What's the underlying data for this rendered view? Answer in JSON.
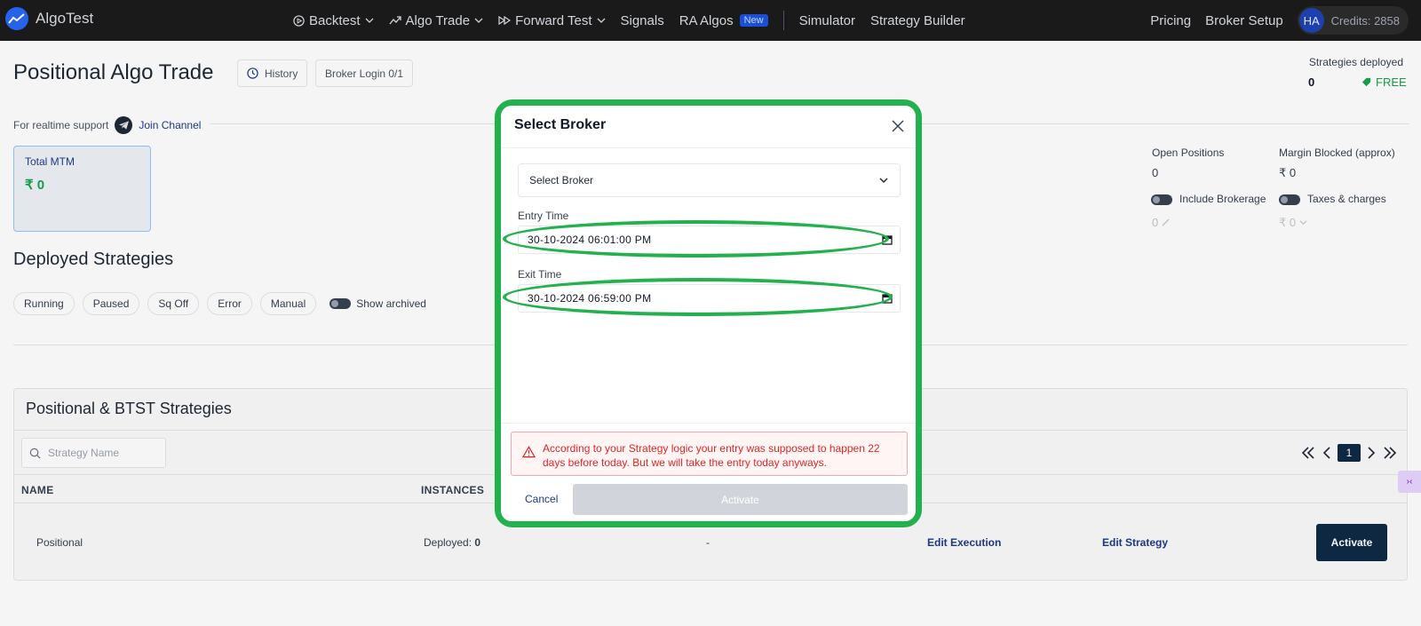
{
  "nav": {
    "brand": "AlgoTest",
    "links": [
      {
        "label": "Backtest",
        "icon": "play-circle-icon",
        "dropdown": true
      },
      {
        "label": "Algo Trade",
        "icon": "trend-up-icon",
        "dropdown": true
      },
      {
        "label": "Forward Test",
        "icon": "fast-forward-icon",
        "dropdown": true
      },
      {
        "label": "Signals"
      },
      {
        "label": "RA Algos",
        "badge": "New"
      }
    ],
    "links2": [
      "Simulator",
      "Strategy Builder"
    ],
    "right": {
      "pricing": "Pricing",
      "broker_setup": "Broker Setup",
      "avatar": "HA",
      "credits": "Credits: 2858"
    }
  },
  "page": {
    "title": "Positional Algo Trade",
    "history_btn": "History",
    "broker_login_btn": "Broker Login 0/1",
    "strategies_deployed_label": "Strategies deployed",
    "strategies_deployed_value": "0",
    "plan": "FREE"
  },
  "support": {
    "text": "For realtime support",
    "link": "Join Channel"
  },
  "mtm": {
    "label": "Total MTM",
    "value": "₹ 0"
  },
  "stats": {
    "open_positions_label": "Open Positions",
    "open_positions_value": "0",
    "margin_label": "Margin Blocked (approx)",
    "margin_value": "₹ 0",
    "include_brokerage": "Include Brokerage",
    "taxes_charges": "Taxes & charges",
    "brokerage_value": "0",
    "taxes_value": "₹ 0"
  },
  "deployed": {
    "title": "Deployed Strategies",
    "filters": [
      "Running",
      "Paused",
      "Sq Off",
      "Error",
      "Manual"
    ],
    "show_archived": "Show archived"
  },
  "strategies": {
    "title": "Positional & BTST Strategies",
    "search_placeholder": "Strategy Name",
    "page": "1",
    "columns": {
      "name": "NAME",
      "instances": "INSTANCES"
    },
    "row": {
      "name": "Positional",
      "deployed_label": "Deployed:",
      "deployed_value": "0",
      "dash": "-",
      "edit_execution": "Edit Execution",
      "edit_strategy": "Edit Strategy",
      "activate": "Activate"
    }
  },
  "side_widget": "›‹",
  "modal": {
    "title": "Select Broker",
    "broker_select": "Select Broker",
    "entry_label": "Entry Time",
    "entry_value": "30-10-2024  06:01:00  PM",
    "exit_label": "Exit Time",
    "exit_value": "30-10-2024  06:59:00  PM",
    "warning": "According to your Strategy logic your entry was supposed to happen 22 days before today. But we will take the entry today anyways.",
    "cancel": "Cancel",
    "activate": "Activate"
  },
  "colors": {
    "accent": "#0f2a44",
    "highlight": "#22b14c",
    "warning": "#dc2626",
    "profit": "#16a34a"
  }
}
